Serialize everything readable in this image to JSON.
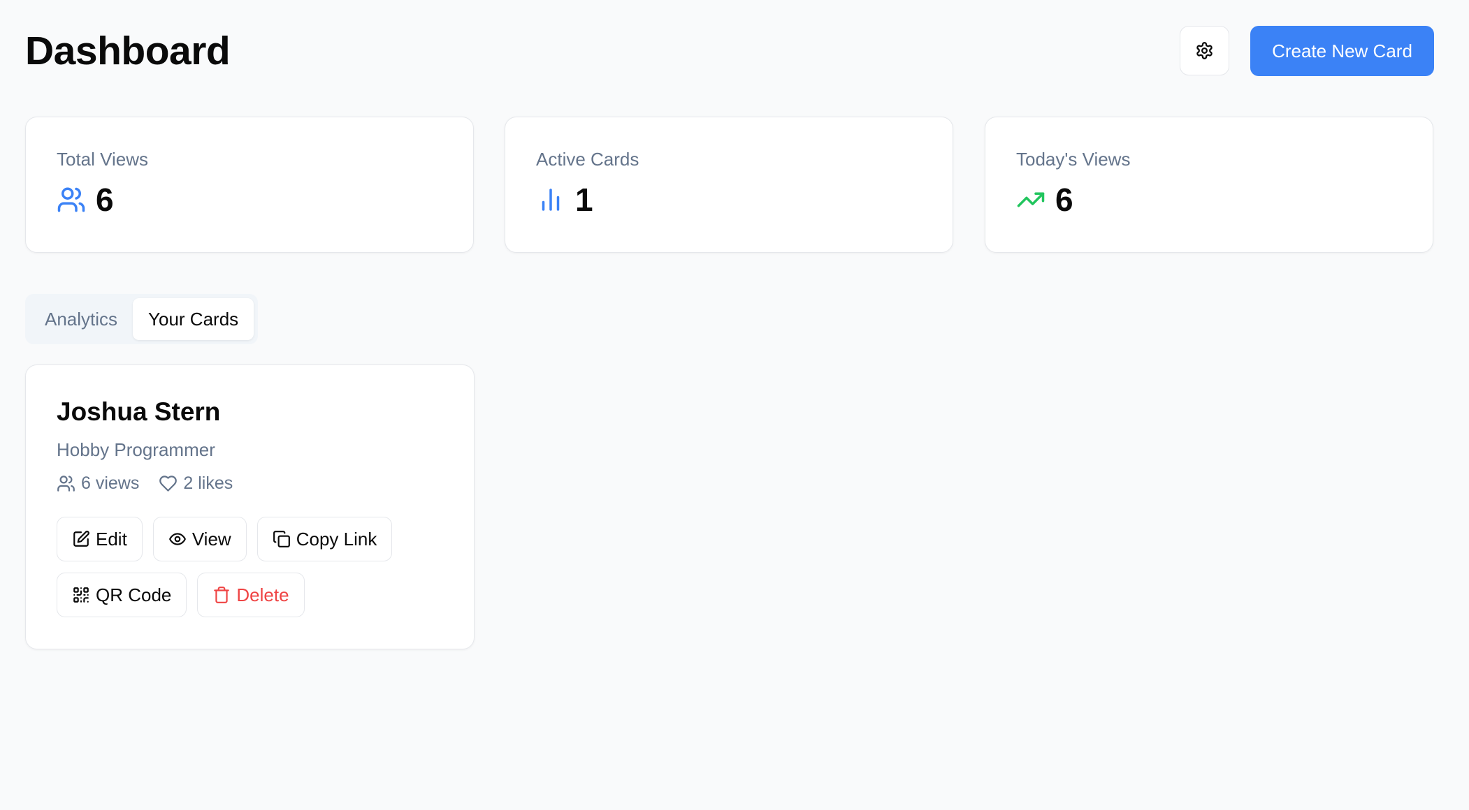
{
  "header": {
    "title": "Dashboard",
    "settings_icon": "gear-icon",
    "create_label": "Create New Card"
  },
  "stats": [
    {
      "label": "Total Views",
      "value": "6",
      "icon": "users-icon",
      "color": "#3b82f6"
    },
    {
      "label": "Active Cards",
      "value": "1",
      "icon": "bar-chart-icon",
      "color": "#3b82f6"
    },
    {
      "label": "Today's Views",
      "value": "6",
      "icon": "trending-up-icon",
      "color": "#22c55e"
    }
  ],
  "tabs": [
    {
      "label": "Analytics",
      "active": false
    },
    {
      "label": "Your Cards",
      "active": true
    }
  ],
  "card": {
    "name": "Joshua Stern",
    "title": "Hobby Programmer",
    "views": "6 views",
    "likes": "2 likes",
    "actions": {
      "edit": "Edit",
      "view": "View",
      "copy_link": "Copy Link",
      "qr_code": "QR Code",
      "delete": "Delete"
    }
  },
  "colors": {
    "accent": "#3b82f6",
    "success": "#22c55e",
    "danger": "#ef4444",
    "muted_text": "#64748b",
    "background": "#f9fafb"
  }
}
